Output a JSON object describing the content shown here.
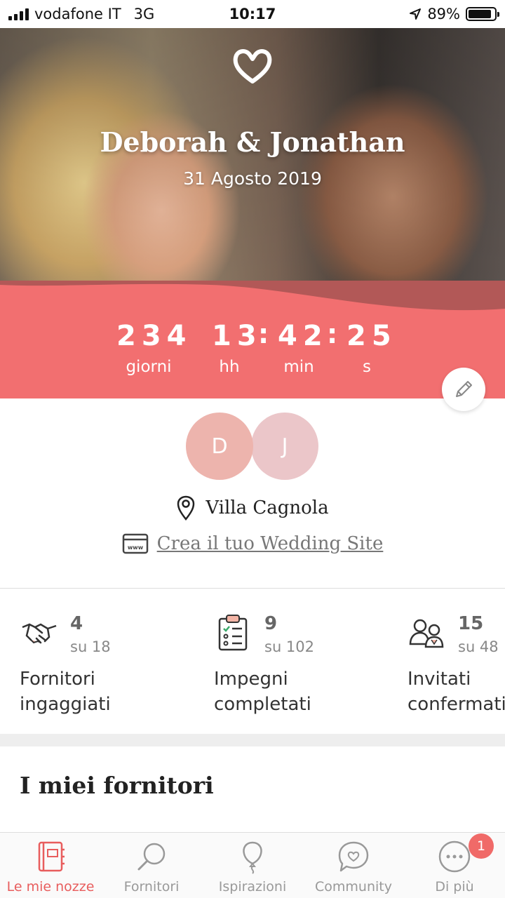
{
  "status_bar": {
    "carrier": "vodafone IT",
    "network": "3G",
    "time": "10:17",
    "battery": "89%",
    "battery_level": 0.89
  },
  "hero": {
    "couple": "Deborah & Jonathan",
    "date": "31 Agosto 2019",
    "logo_icon": "heart-icon"
  },
  "countdown": {
    "days": "234",
    "hours": "13",
    "minutes": "42",
    "seconds": "25",
    "labels": {
      "days": "giorni",
      "hours": "hh",
      "minutes": "min",
      "seconds": "s"
    }
  },
  "avatars": [
    "D",
    "J"
  ],
  "venue": "Villa Cagnola",
  "website_link": "Crea il tuo Wedding Site",
  "stats": [
    {
      "icon": "handshake-icon",
      "value": "4",
      "of": "su 18",
      "label_line1": "Fornitori",
      "label_line2": "ingaggiati"
    },
    {
      "icon": "checklist-icon",
      "value": "9",
      "of": "su 102",
      "label_line1": "Impegni",
      "label_line2": "completati"
    },
    {
      "icon": "guests-icon",
      "value": "15",
      "of": "su 48",
      "label_line1": "Invitati",
      "label_line2": "confermati"
    }
  ],
  "section_title": "I miei fornitori",
  "tabs": [
    {
      "label": "Le mie nozze",
      "icon": "notebook-icon",
      "active": true
    },
    {
      "label": "Fornitori",
      "icon": "magnifier-icon",
      "active": false
    },
    {
      "label": "Ispirazioni",
      "icon": "balloon-icon",
      "active": false
    },
    {
      "label": "Community",
      "icon": "chat-heart-icon",
      "active": false
    },
    {
      "label": "Di più",
      "icon": "more-icon",
      "active": false
    }
  ],
  "more_badge": "1",
  "colors": {
    "accent": "#f26f70",
    "avatar_d": "#edb4ad",
    "avatar_j": "#ebc6c9"
  }
}
